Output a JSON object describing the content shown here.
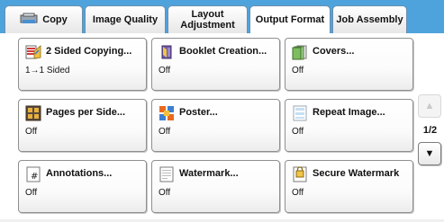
{
  "tabs": [
    {
      "label": "Copy",
      "icon": "copy-icon"
    },
    {
      "label": "Image Quality"
    },
    {
      "label": "Layout\nAdjustment"
    },
    {
      "label": "Output Format",
      "active": true
    },
    {
      "label": "Job Assembly"
    }
  ],
  "tiles": [
    {
      "label": "2 Sided Copying...",
      "value": "1→1 Sided",
      "icon": "two-sided-copying-icon"
    },
    {
      "label": "Booklet Creation...",
      "value": "Off",
      "icon": "booklet-icon"
    },
    {
      "label": "Covers...",
      "value": "Off",
      "icon": "covers-icon"
    },
    {
      "label": "Pages per Side...",
      "value": "Off",
      "icon": "pages-per-side-icon"
    },
    {
      "label": "Poster...",
      "value": "Off",
      "icon": "poster-icon"
    },
    {
      "label": "Repeat Image...",
      "value": "Off",
      "icon": "repeat-image-icon"
    },
    {
      "label": "Annotations...",
      "value": "Off",
      "icon": "annotations-icon"
    },
    {
      "label": "Watermark...",
      "value": "Off",
      "icon": "watermark-icon"
    },
    {
      "label": "Secure Watermark",
      "value": "Off",
      "icon": "secure-watermark-icon"
    }
  ],
  "pager": {
    "indicator": "1/2",
    "up": "▲",
    "down": "▼"
  },
  "colors": {
    "tabbar": "#4fa3dc"
  }
}
